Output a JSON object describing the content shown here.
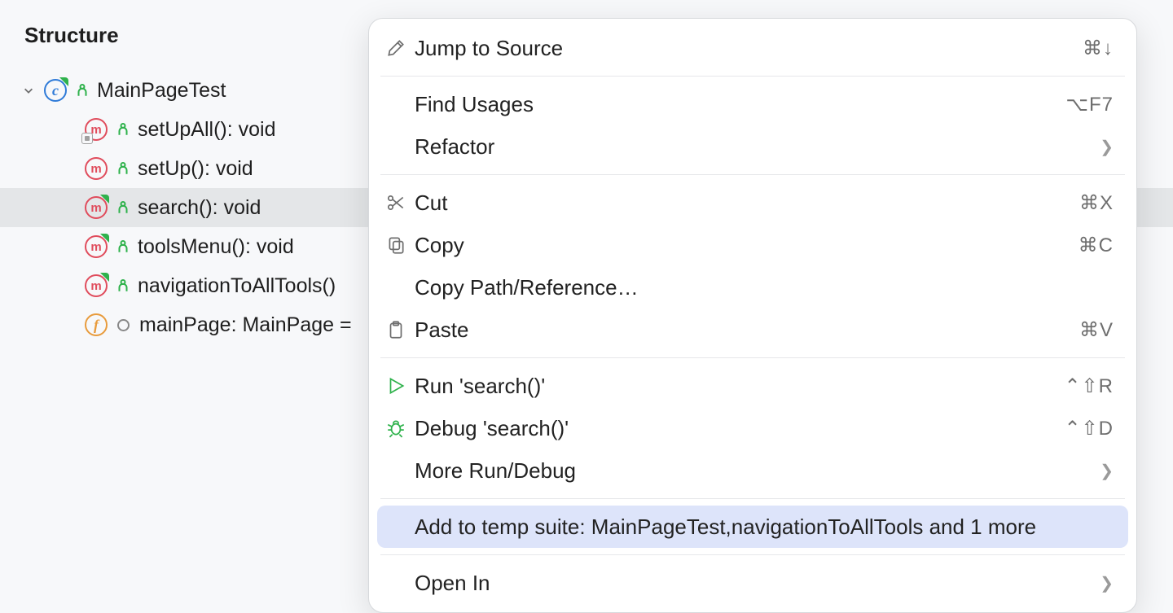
{
  "panel": {
    "title": "Structure"
  },
  "tree": {
    "root": {
      "label": "MainPageTest"
    },
    "children": [
      {
        "kind": "method-overlay",
        "label": "setUpAll(): void"
      },
      {
        "kind": "method",
        "label": "setUp(): void"
      },
      {
        "kind": "method-badge",
        "label": "search(): void",
        "selected": true
      },
      {
        "kind": "method-badge",
        "label": "toolsMenu(): void"
      },
      {
        "kind": "method-badge",
        "label": "navigationToAllTools()"
      },
      {
        "kind": "field",
        "label": "mainPage: MainPage ="
      }
    ]
  },
  "menu": {
    "items": [
      {
        "icon": "pencil",
        "label": "Jump to Source",
        "shortcut": "⌘↓"
      },
      {
        "sep": true
      },
      {
        "icon": "",
        "label": "Find Usages",
        "shortcut": "⌥F7"
      },
      {
        "icon": "",
        "label": "Refactor",
        "submenu": true
      },
      {
        "sep": true
      },
      {
        "icon": "cut",
        "label": "Cut",
        "shortcut": "⌘X"
      },
      {
        "icon": "copy",
        "label": "Copy",
        "shortcut": "⌘C"
      },
      {
        "icon": "",
        "label": "Copy Path/Reference…"
      },
      {
        "icon": "paste",
        "label": "Paste",
        "shortcut": "⌘V"
      },
      {
        "sep": true
      },
      {
        "icon": "run",
        "label": "Run 'search()'",
        "shortcut": "⌃⇧R"
      },
      {
        "icon": "debug",
        "label": "Debug 'search()'",
        "shortcut": "⌃⇧D"
      },
      {
        "icon": "",
        "label": "More Run/Debug",
        "submenu": true
      },
      {
        "sep": true
      },
      {
        "icon": "",
        "label": "Add to temp suite: MainPageTest,navigationToAllTools and 1 more",
        "highlighted": true
      },
      {
        "sep": true
      },
      {
        "icon": "",
        "label": "Open In",
        "submenu": true
      }
    ]
  }
}
